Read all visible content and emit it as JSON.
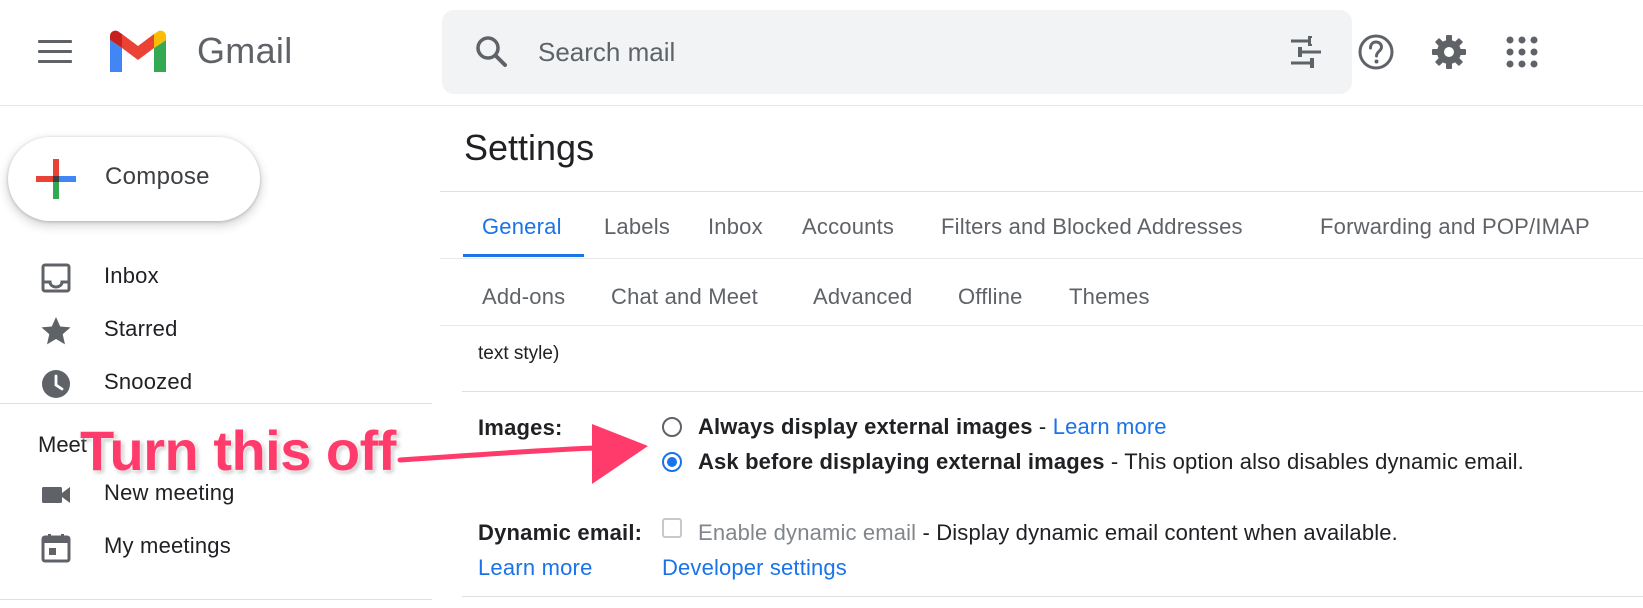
{
  "header": {
    "app_name": "Gmail",
    "search_placeholder": "Search mail"
  },
  "compose": {
    "label": "Compose"
  },
  "sidebar": {
    "items": [
      {
        "label": "Inbox",
        "icon": "inbox-icon"
      },
      {
        "label": "Starred",
        "icon": "star-icon"
      },
      {
        "label": "Snoozed",
        "icon": "clock-icon"
      }
    ],
    "meet_heading": "Meet",
    "meet_items": [
      {
        "label": "New meeting",
        "icon": "videocam-icon"
      },
      {
        "label": "My meetings",
        "icon": "calendar-icon"
      }
    ]
  },
  "settings": {
    "title": "Settings",
    "tabs_row1": [
      "General",
      "Labels",
      "Inbox",
      "Accounts",
      "Filters and Blocked Addresses",
      "Forwarding and POP/IMAP"
    ],
    "tabs_row2": [
      "Add-ons",
      "Chat and Meet",
      "Advanced",
      "Offline",
      "Themes"
    ],
    "active_tab": "General",
    "previous_text": "text style)",
    "images": {
      "label": "Images:",
      "option1_bold": "Always display external images",
      "option1_sep": " - ",
      "option1_link": "Learn more",
      "option2_bold": "Ask before displaying external images",
      "option2_rest": " - This option also disables dynamic email.",
      "selected": "option2"
    },
    "dynamic_email": {
      "label": "Dynamic email:",
      "checkbox_label": "Enable dynamic email",
      "rest": " - Display dynamic email content when available.",
      "learn_more": "Learn more",
      "developer_settings": "Developer settings",
      "checked": false
    }
  },
  "annotation": {
    "text": "Turn this off",
    "color": "#ff3b6b"
  },
  "colors": {
    "accent": "#1a73e8",
    "text": "#202124",
    "muted": "#5f6368"
  }
}
